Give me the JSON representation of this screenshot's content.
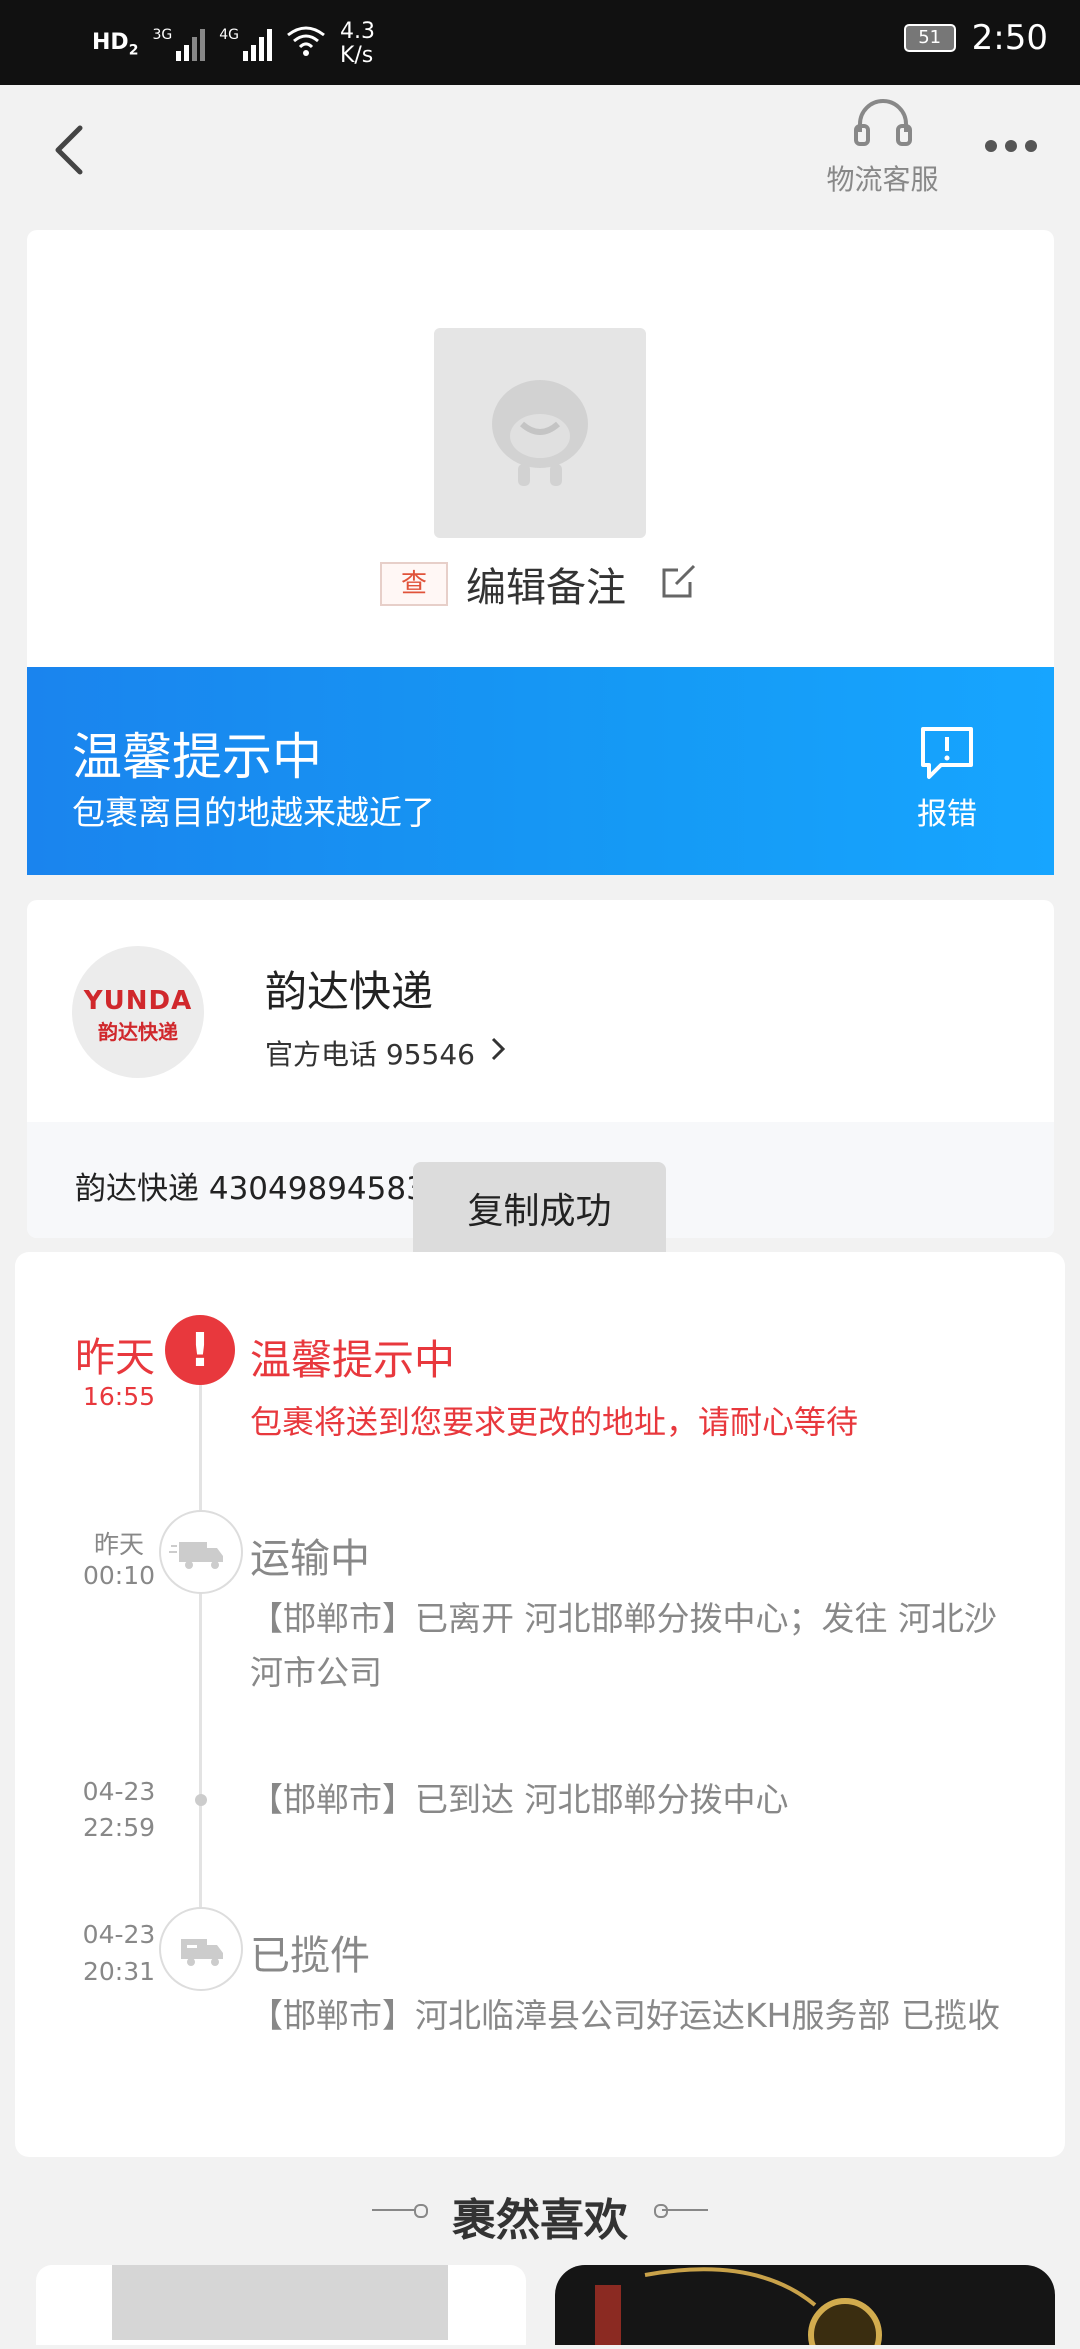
{
  "status_bar": {
    "hd": "HD",
    "hd_sub": "2",
    "net1": "3G",
    "net2": "4G",
    "speed_value": "4.3",
    "speed_unit": "K/s",
    "battery": "51",
    "time": "2:50"
  },
  "header": {
    "customer_service_label": "物流客服"
  },
  "package": {
    "tag": "查",
    "edit_note_label": "编辑备注"
  },
  "banner": {
    "title": "温馨提示中",
    "subtitle": "包裹离目的地越来越近了",
    "report_label": "报错"
  },
  "courier": {
    "logo_en": "YUNDA",
    "logo_cn": "韵达快递",
    "name": "韵达快递",
    "phone": "官方电话 95546",
    "tracking": "韵达快递 4304989458331"
  },
  "toast": "复制成功",
  "timeline": [
    {
      "day": "昨天",
      "time": "16:55",
      "title": "温馨提示中",
      "desc": "包裹将送到您要求更改的地址，请耐心等待",
      "icon": "alert-icon"
    },
    {
      "day": "昨天",
      "time": "00:10",
      "title": "运输中",
      "desc": "【邯郸市】已离开 河北邯郸分拨中心；发往 河北沙河市公司",
      "icon": "truck-icon"
    },
    {
      "day": "04-23",
      "time": "22:59",
      "desc": "【邯郸市】已到达 河北邯郸分拨中心",
      "icon": "dot"
    },
    {
      "day": "04-23",
      "time": "20:31",
      "title": "已揽件",
      "desc": "【邯郸市】河北临漳县公司好运达KH服务部 已揽收",
      "icon": "pickup-truck-icon"
    }
  ],
  "recommend": {
    "title": "裹然喜欢"
  },
  "colors": {
    "accent_blue": "#1a8cf0",
    "alert_red": "#e8383d",
    "brand_red": "#d0282c"
  }
}
